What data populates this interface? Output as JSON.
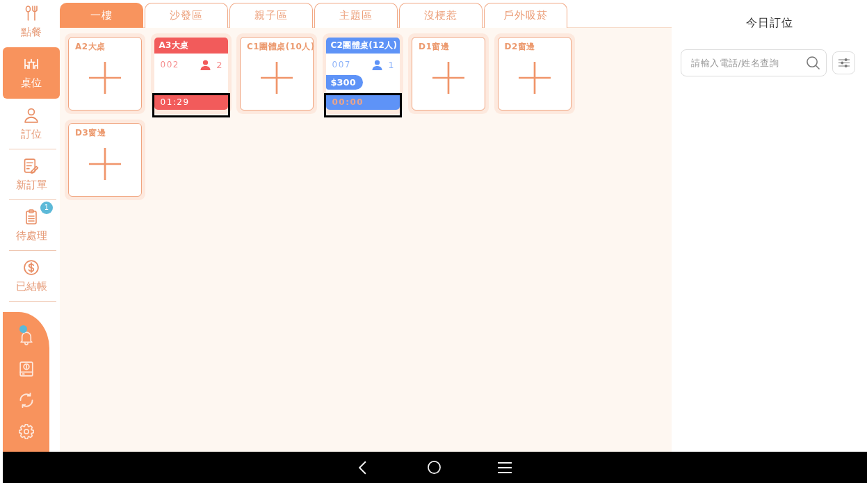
{
  "sidebar": {
    "items": [
      {
        "label": "點餐",
        "selected": false
      },
      {
        "label": "桌位",
        "selected": true
      },
      {
        "label": "訂位",
        "selected": false
      },
      {
        "label": "新訂單",
        "selected": false
      },
      {
        "label": "待處理",
        "selected": false,
        "badge": "1"
      },
      {
        "label": "已結帳",
        "selected": false
      }
    ]
  },
  "tools": [
    {
      "dot": true
    },
    {
      "dot": false
    },
    {
      "dot": false
    },
    {
      "dot": false
    }
  ],
  "tabs": [
    {
      "label": "一樓",
      "selected": true
    },
    {
      "label": "沙發區",
      "selected": false
    },
    {
      "label": "親子區",
      "selected": false
    },
    {
      "label": "主題區",
      "selected": false
    },
    {
      "label": "沒梗惹",
      "selected": false
    },
    {
      "label": "戶外吸菸",
      "selected": false
    }
  ],
  "tables": [
    {
      "name": "A2大桌",
      "kind": "empty",
      "highlighted": false
    },
    {
      "name": "A3大桌",
      "kind": "occupied",
      "color": "#f25b5b",
      "order_no": "002",
      "guests": "2",
      "timer": "01:29",
      "timer_dimmed": false,
      "highlighted": true
    },
    {
      "name": "C1團體桌(10人)",
      "kind": "empty",
      "highlighted": false
    },
    {
      "name": "C2團體桌(12人)",
      "kind": "occupied",
      "color": "#5e93f7",
      "order_no": "007",
      "guests": "1",
      "amount": "$300",
      "timer": "00:00",
      "timer_dimmed": true,
      "highlighted": true
    },
    {
      "name": "D1窗邊",
      "kind": "empty",
      "highlighted": false
    },
    {
      "name": "D2窗邊",
      "kind": "empty",
      "highlighted": false
    },
    {
      "name": "D3窗邊",
      "kind": "empty",
      "highlighted": false
    }
  ],
  "reservations": {
    "title": "今日訂位",
    "search": {
      "placeholder": "請輸入電話/姓名查詢"
    }
  }
}
